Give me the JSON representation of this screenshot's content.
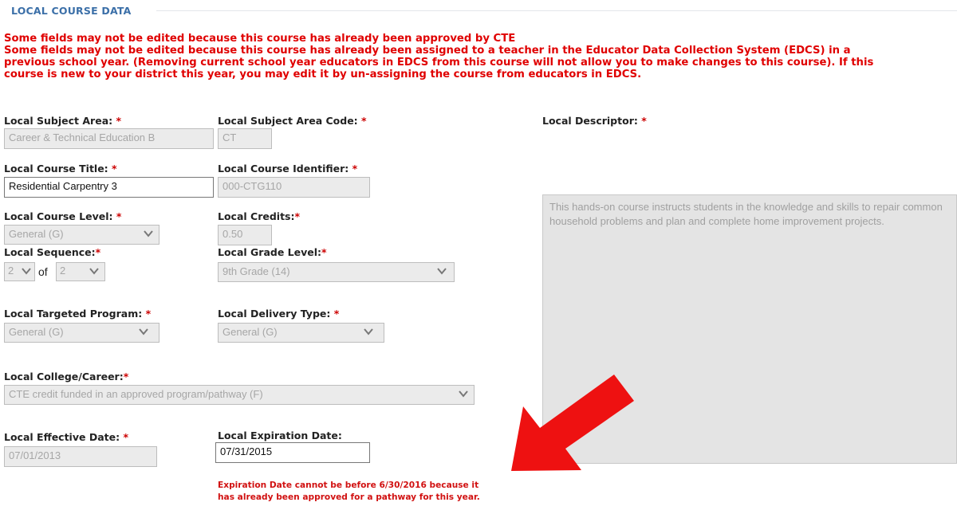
{
  "section": {
    "title": "LOCAL COURSE DATA"
  },
  "warnings": [
    "Some fields may not be edited because this course has already been approved by CTE",
    "Some fields may not be edited because this course has already been assigned to a teacher in the Educator Data Collection System (EDCS) in a",
    "previous school year. (Removing current school year educators in EDCS from this course will not allow you to make changes to this course). If this",
    "course is new to your district this year, you may edit it by un-assigning the course from educators in EDCS."
  ],
  "required_mark": "*",
  "fields": {
    "subject_area": {
      "label": "Local Subject Area:",
      "value": "Career & Technical Education B"
    },
    "subject_area_code": {
      "label": "Local Subject Area Code:",
      "value": "CT"
    },
    "descriptor": {
      "label": "Local Descriptor:",
      "value": "This hands-on course instructs students in the knowledge and skills to repair common household problems and plan and complete home improvement projects."
    },
    "course_title": {
      "label": "Local Course Title:",
      "value": "Residential Carpentry 3"
    },
    "course_identifier": {
      "label": "Local Course Identifier:",
      "value": "000-CTG110"
    },
    "course_level": {
      "label": "Local Course Level:",
      "value": "General (G)"
    },
    "credits": {
      "label": "Local Credits:",
      "value": "0.50"
    },
    "sequence": {
      "label": "Local Sequence:",
      "value": "2",
      "of_label": "of",
      "total": "2"
    },
    "grade_level": {
      "label": "Local Grade Level:",
      "value": "9th Grade (14)"
    },
    "targeted_program": {
      "label": "Local Targeted Program:",
      "value": "General (G)"
    },
    "delivery_type": {
      "label": "Local Delivery Type:",
      "value": "General (G)"
    },
    "college_career": {
      "label": "Local College/Career:",
      "value": "CTE credit funded in an approved program/pathway (F)"
    },
    "effective_date": {
      "label": "Local Effective Date:",
      "value": "07/01/2013"
    },
    "expiration_date": {
      "label": "Local Expiration Date:",
      "value": "07/31/2015"
    }
  },
  "expiration_error": {
    "line1": "Expiration Date cannot be before 6/30/2016 because it",
    "line2": "has already been approved for a pathway for this year."
  },
  "colors": {
    "header": "#3b6fa8",
    "warning": "#e00000",
    "required": "#cc0000",
    "arrow": "#ee1111",
    "disabled_bg": "#ebebeb"
  },
  "icons": {
    "dropdown": "chevron-down-icon",
    "annotation": "red-arrow"
  }
}
